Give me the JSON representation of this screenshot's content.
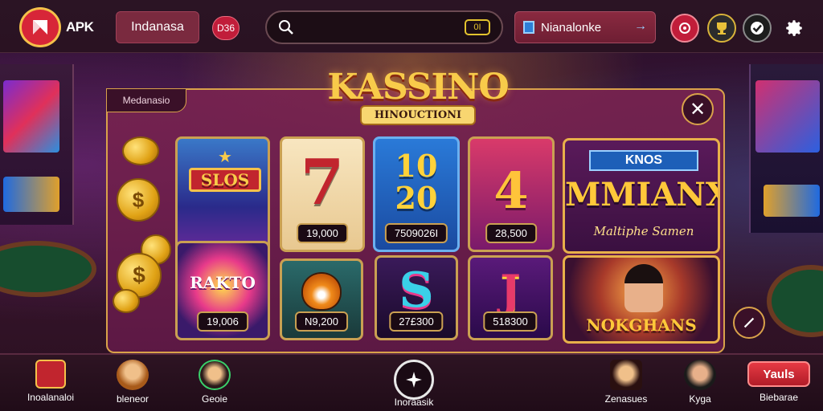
{
  "header": {
    "brand": "APK",
    "language_label": "Indanasa",
    "badge_label": "D36",
    "search_placeholder": "",
    "search_shortcut": "0I",
    "promo_label": "Nianalonke"
  },
  "hero": {
    "title": "KASSINO",
    "subtitle": "HINOUCTIONI"
  },
  "panel": {
    "tag_label": "Medanasio"
  },
  "games": [
    {
      "name": "SLOS",
      "value": "19,006"
    },
    {
      "name": "7",
      "value": "19,000"
    },
    {
      "name": "10 20",
      "value": "7509026I"
    },
    {
      "name": "4",
      "value": "28,500"
    },
    {
      "name": "RAKTO",
      "value": "19,006"
    },
    {
      "name": "tiger",
      "value": "N9,200"
    },
    {
      "name": "S",
      "value": "27£300"
    },
    {
      "name": "J",
      "value": "518300"
    }
  ],
  "feature": {
    "title_top": "KNOS",
    "title_main": "MMIANX",
    "title_sub": "Maltiphe Samen",
    "caption": "NOKGHANS"
  },
  "bottom_nav": {
    "items": [
      {
        "label": "Inoalanaloi"
      },
      {
        "label": "bleneor"
      },
      {
        "label": "Geoie"
      },
      {
        "label": "Inoraasik"
      },
      {
        "label": "Zenasues"
      },
      {
        "label": "Kyga"
      }
    ],
    "cta_label": "Yauls",
    "cta_sub": "Biebarae"
  },
  "colors": {
    "accent_gold": "#d9a24a",
    "accent_red": "#d72638",
    "panel_purple": "#7a2350"
  }
}
